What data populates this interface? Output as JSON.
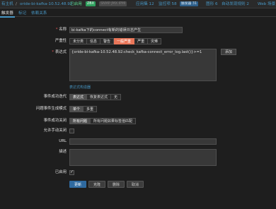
{
  "topnav": {
    "all_hosts": "有主机",
    "sep1": "/",
    "host_name": "oride-bi-kafka-10.52.48.92",
    "status": "已启用",
    "zbx": "ZBX",
    "snmp": "SNMP JMX IPMI",
    "apps": "应用集 12",
    "items": "监控项 58",
    "triggers": "触发器 31",
    "graphs": "图形 6",
    "discovery": "自动发现规则 2",
    "web": "Web 场景"
  },
  "tabs": [
    "触发器",
    "标记",
    "依赖关系"
  ],
  "form": {
    "name_label": "名称",
    "name_value": "bi-kafka下的connect有新的错误日志产生",
    "severity_label": "严重性",
    "severity_options": [
      "未分类",
      "信息",
      "警告",
      "一般严重",
      "严重",
      "灾难"
    ],
    "severity_selected": "一般严重",
    "expression_label": "表达式",
    "expression_value": "{oride-bi-kafka-10.52.48.92:check_kafka-connect_error_log.last()}>=1",
    "add_button": "添加",
    "expr_constructor_link": "表达式构造器",
    "ok_event_gen_label": "事件成功迭代",
    "ok_event_gen_options": [
      "表达式",
      "恢复表达式",
      "无"
    ],
    "ok_event_gen_selected": "表达式",
    "problem_mode_label": "问题事件生成模式",
    "problem_mode_options": [
      "单个",
      "多重"
    ],
    "problem_mode_selected": "单个",
    "ok_close_label": "事件成功关闭",
    "ok_close_options": [
      "所有问题",
      "所有问题如果标签值匹配"
    ],
    "ok_close_selected": "所有问题",
    "manual_close_label": "允许手动关闭",
    "url_label": "URL",
    "description_label": "描述",
    "enabled_label": "已启用",
    "enabled_checked": true
  },
  "buttons": [
    "更新",
    "克隆",
    "删除",
    "取消"
  ]
}
